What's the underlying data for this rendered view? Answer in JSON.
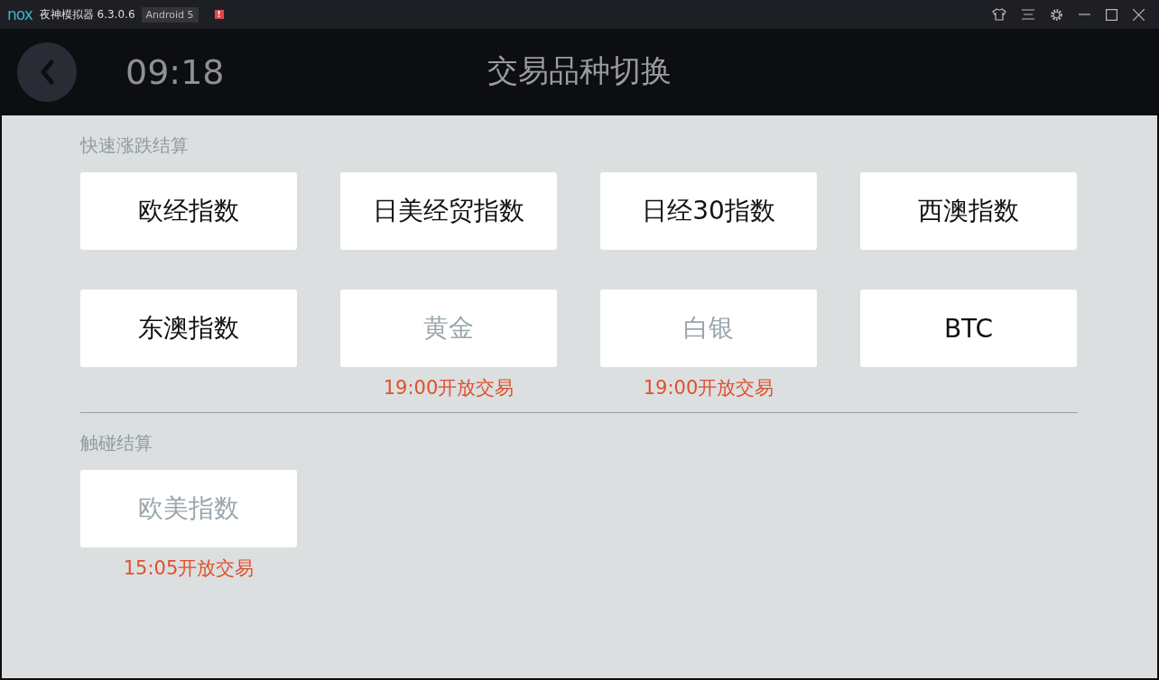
{
  "window": {
    "logo": "nox",
    "title": "夜神模拟器 6.3.0.6",
    "badge": "Android 5",
    "alert": "!"
  },
  "header": {
    "time": "09:18",
    "title": "交易品种切换"
  },
  "sections": [
    {
      "title": "快速涨跌结算",
      "items": [
        {
          "name": "欧经指数",
          "disabled": false
        },
        {
          "name": "日美经贸指数",
          "disabled": false
        },
        {
          "name": "日经30指数",
          "disabled": false
        },
        {
          "name": "西澳指数",
          "disabled": false
        },
        {
          "name": "东澳指数",
          "disabled": false
        },
        {
          "name": "黄金",
          "disabled": true,
          "note": "19:00开放交易"
        },
        {
          "name": "白银",
          "disabled": true,
          "note": "19:00开放交易"
        },
        {
          "name": "BTC",
          "disabled": false
        }
      ]
    },
    {
      "title": "触碰结算",
      "items": [
        {
          "name": "欧美指数",
          "disabled": true,
          "note": "15:05开放交易"
        }
      ]
    }
  ]
}
